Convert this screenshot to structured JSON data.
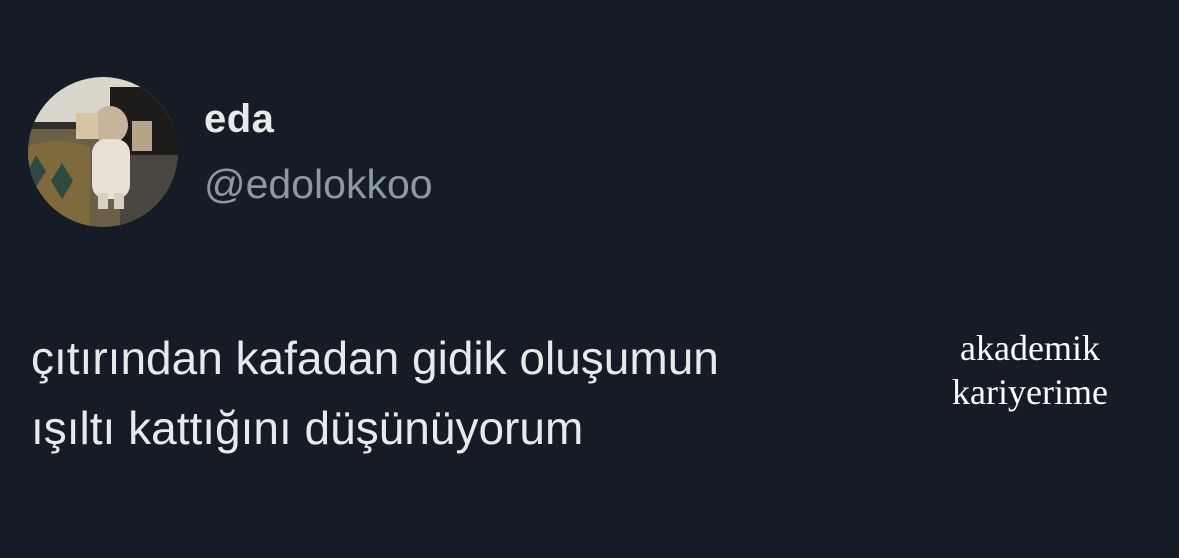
{
  "profile": {
    "display_name": "eda",
    "handle": "@edolokkoo",
    "avatar_icon": "profile-photo"
  },
  "tweet": {
    "lines": [
      "çıtırından kafadan gidik oluşumun",
      "ışıltı kattığını düşünüyorum"
    ]
  },
  "overlay": {
    "lines": [
      "akademik",
      "kariyerime"
    ]
  },
  "colors": {
    "background": "#151c26",
    "primary_text": "#e7e9ea",
    "secondary_text": "#8b98a5",
    "overlay_text": "#ffffff"
  }
}
